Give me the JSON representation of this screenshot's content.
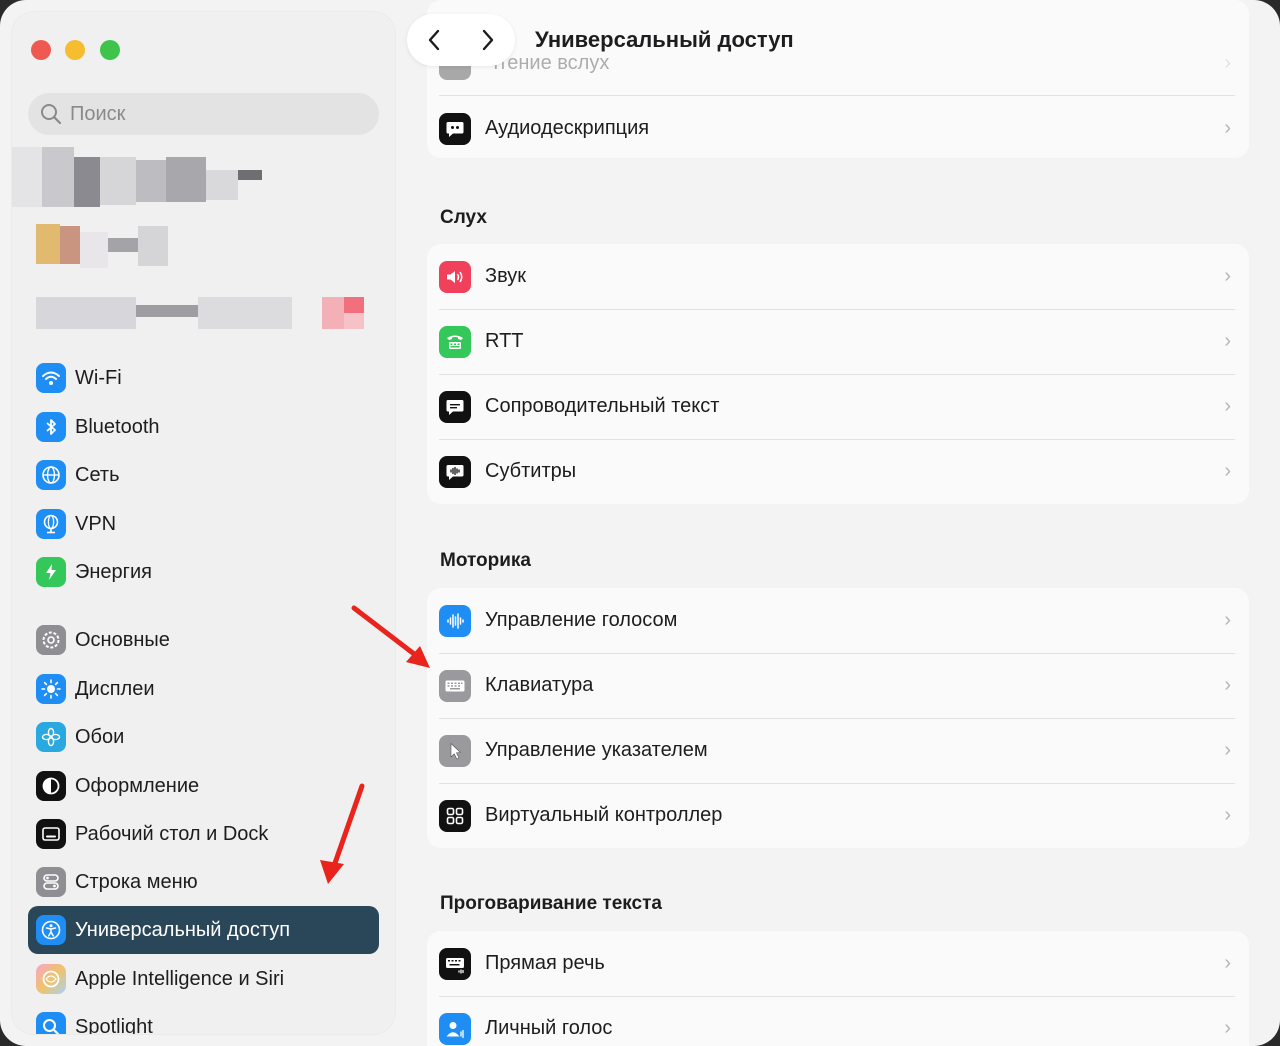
{
  "window": {
    "title": "Универсальный доступ"
  },
  "sidebar": {
    "search_placeholder": "Поиск",
    "items": [
      {
        "label": "Wi-Fi",
        "icon": "wifi-icon",
        "color": "#1e8ef5"
      },
      {
        "label": "Bluetooth",
        "icon": "bluetooth-icon",
        "color": "#1e8ef5"
      },
      {
        "label": "Сеть",
        "icon": "globe-icon",
        "color": "#1e8ef5"
      },
      {
        "label": "VPN",
        "icon": "vpn-globe-icon",
        "color": "#1e8ef5"
      },
      {
        "label": "Энергия",
        "icon": "bolt-icon",
        "color": "#34c759"
      },
      {
        "label": "Основные",
        "icon": "gear-icon",
        "color": "#8e8e93"
      },
      {
        "label": "Дисплеи",
        "icon": "sun-icon",
        "color": "#1e8ef5"
      },
      {
        "label": "Обои",
        "icon": "flower-icon",
        "color": "#2aa9e0"
      },
      {
        "label": "Оформление",
        "icon": "appearance-icon",
        "color": "#111111"
      },
      {
        "label": "Рабочий стол и Dock",
        "icon": "dock-icon",
        "color": "#111111"
      },
      {
        "label": "Строка меню",
        "icon": "menubar-icon",
        "color": "#8e8e93"
      },
      {
        "label": "Универсальный доступ",
        "icon": "accessibility-icon",
        "color": "#1e8ef5"
      },
      {
        "label": "Apple Intelligence и Siri",
        "icon": "siri-icon",
        "color": "#e06bd0"
      },
      {
        "label": "Spotlight",
        "icon": "spotlight-icon",
        "color": "#1e8ef5"
      }
    ]
  },
  "main": {
    "top_partial": {
      "label": "Чтение вслух"
    },
    "top_card": [
      {
        "label": "Аудиодескрипция",
        "icon": "audio-description-icon",
        "color": "#111111"
      }
    ],
    "sections": [
      {
        "title": "Слух",
        "rows": [
          {
            "label": "Звук",
            "icon": "speaker-icon",
            "color": "#f0405c"
          },
          {
            "label": "RTT",
            "icon": "rtt-icon",
            "color": "#34c759"
          },
          {
            "label": "Сопроводительный текст",
            "icon": "caption-bubble-icon",
            "color": "#111111"
          },
          {
            "label": "Субтитры",
            "icon": "subtitles-icon",
            "color": "#111111"
          }
        ]
      },
      {
        "title": "Моторика",
        "rows": [
          {
            "label": "Управление голосом",
            "icon": "voice-control-icon",
            "color": "#1e8ef5"
          },
          {
            "label": "Клавиатура",
            "icon": "keyboard-icon",
            "color": "#9a9a9e"
          },
          {
            "label": "Управление указателем",
            "icon": "pointer-icon",
            "color": "#9a9a9e"
          },
          {
            "label": "Виртуальный контроллер",
            "icon": "grid-icon",
            "color": "#111111"
          }
        ]
      },
      {
        "title": "Проговаривание текста",
        "rows": [
          {
            "label": "Прямая речь",
            "icon": "live-speech-icon",
            "color": "#111111"
          },
          {
            "label": "Личный голос",
            "icon": "personal-voice-icon",
            "color": "#1e8ef5"
          }
        ]
      }
    ]
  },
  "chevron": "›"
}
